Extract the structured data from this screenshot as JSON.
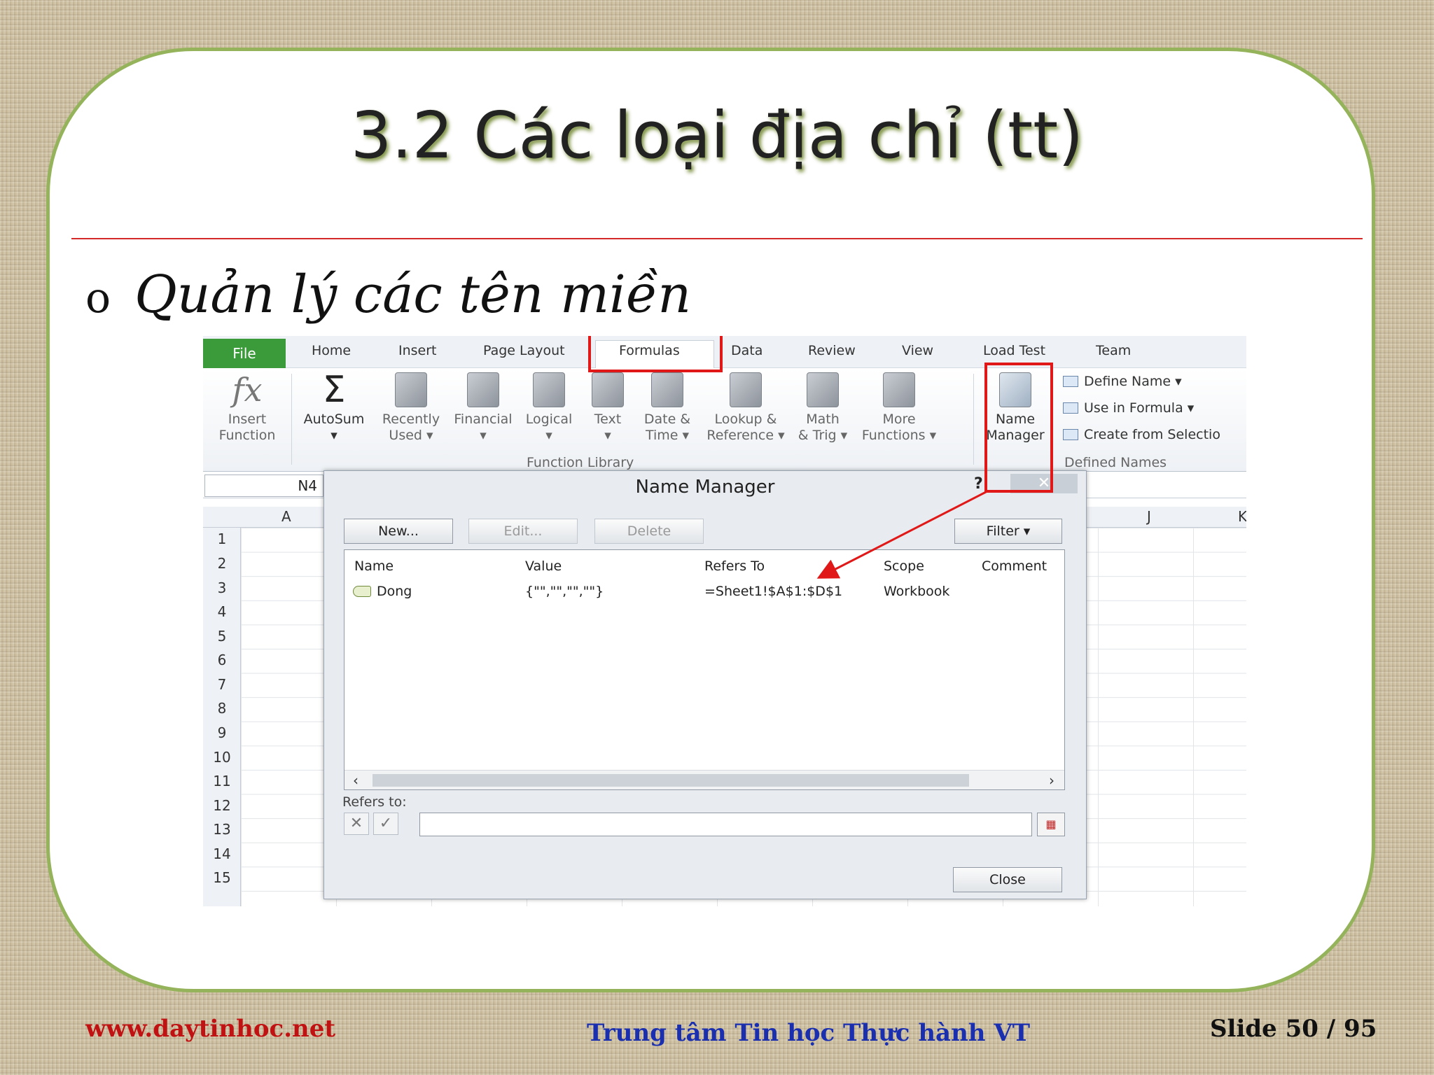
{
  "slide": {
    "title": "3.2 Các loại địa chỉ (tt)",
    "bullet_mark": "o",
    "bullet_text": "Quản lý các tên miền"
  },
  "ribbon": {
    "tabs": [
      "File",
      "Home",
      "Insert",
      "Page Layout",
      "Formulas",
      "Data",
      "Review",
      "View",
      "Load Test",
      "Team"
    ],
    "buttons": [
      {
        "l1": "Insert",
        "l2": "Function"
      },
      {
        "l1": "AutoSum",
        "l2": "▾"
      },
      {
        "l1": "Recently",
        "l2": "Used ▾"
      },
      {
        "l1": "Financial",
        "l2": "▾"
      },
      {
        "l1": "Logical",
        "l2": "▾"
      },
      {
        "l1": "Text",
        "l2": "▾"
      },
      {
        "l1": "Date &",
        "l2": "Time ▾"
      },
      {
        "l1": "Lookup &",
        "l2": "Reference ▾"
      },
      {
        "l1": "Math",
        "l2": "& Trig ▾"
      },
      {
        "l1": "More",
        "l2": "Functions ▾"
      },
      {
        "l1": "Name",
        "l2": "Manager"
      }
    ],
    "group_function_library": "Function Library",
    "group_defined_names": "Defined Names",
    "defined_names_items": [
      "Define Name ▾",
      "Use in Formula ▾",
      "Create from Selectio"
    ]
  },
  "sheet": {
    "name_box": "N4",
    "col_a": "A",
    "col_j": "J",
    "col_k": "K",
    "rows": [
      "1",
      "2",
      "3",
      "4",
      "5",
      "6",
      "7",
      "8",
      "9",
      "10",
      "11",
      "12",
      "13",
      "14",
      "15"
    ]
  },
  "dialog": {
    "title": "Name Manager",
    "help": "?",
    "close_x": "✕",
    "buttons": {
      "new": "New...",
      "edit": "Edit...",
      "delete": "Delete",
      "filter": "Filter ▾",
      "close": "Close"
    },
    "columns": [
      "Name",
      "Value",
      "Refers To",
      "Scope",
      "Comment"
    ],
    "rows": [
      {
        "name": "Dong",
        "value": "{\"\",\"\",\"\",\"\"}",
        "refers_to": "=Sheet1!$A$1:$D$1",
        "scope": "Workbook",
        "comment": ""
      }
    ],
    "refers_to_label": "Refers to:"
  },
  "footer": {
    "left": "www.daytinhoc.net",
    "center": "Trung tâm Tin học Thực hành VT",
    "right": "Slide 50  / 95"
  },
  "colors": {
    "panel_border": "#94b35a",
    "highlight": "#e01818",
    "footer_red": "#c01212",
    "footer_blue": "#1a2fb0"
  }
}
